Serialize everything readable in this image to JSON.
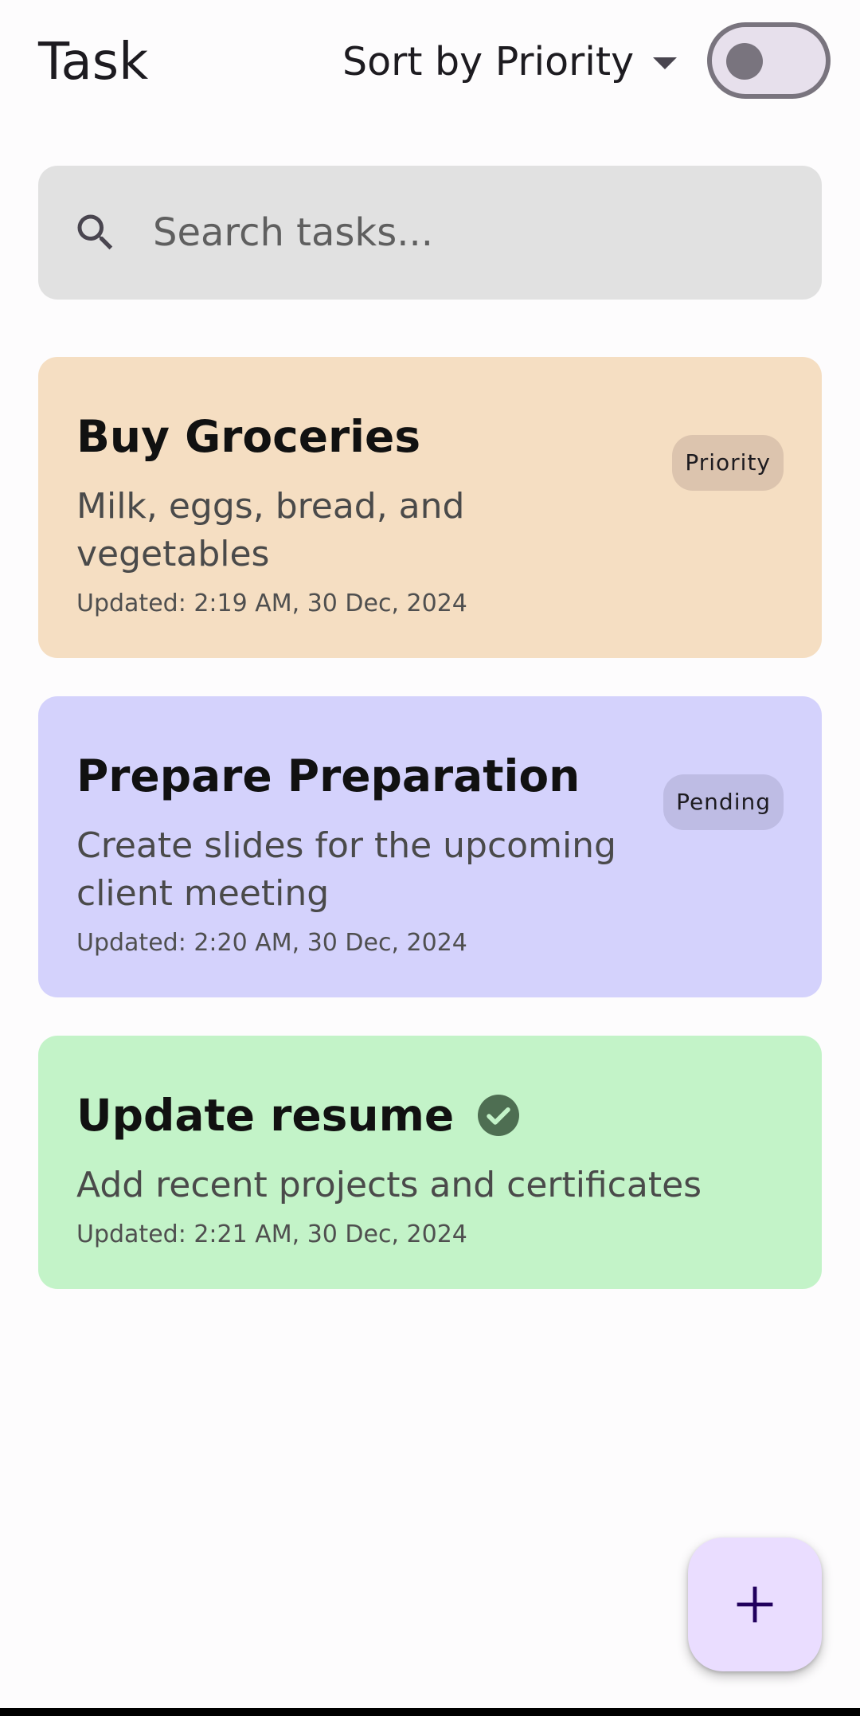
{
  "header": {
    "title": "Task",
    "sort_label": "Sort by Priority",
    "theme_toggle_on": false
  },
  "search": {
    "placeholder": "Search tasks...",
    "value": ""
  },
  "tasks": [
    {
      "title": "Buy Groceries",
      "description": "Milk, eggs, bread, and vegetables",
      "updated": "Updated: 2:19 AM, 30 Dec, 2024",
      "badge": "Priority",
      "completed": false,
      "card_color": "#f5dec2",
      "badge_color": "#dcc4ae"
    },
    {
      "title": "Prepare Preparation",
      "description": "Create slides for the upcoming client meeting",
      "updated": "Updated: 2:20 AM, 30 Dec, 2024",
      "badge": "Pending",
      "completed": false,
      "card_color": "#d4d2fc",
      "badge_color": "#bebce4"
    },
    {
      "title": "Update resume",
      "description": "Add recent projects and certificates",
      "updated": "Updated: 2:21 AM, 30 Dec, 2024",
      "badge": "",
      "completed": true,
      "card_color": "#c3f3c8",
      "check_color": "#4e6e52"
    }
  ],
  "fab": {
    "icon": "add-icon",
    "color": "#eaddff"
  }
}
